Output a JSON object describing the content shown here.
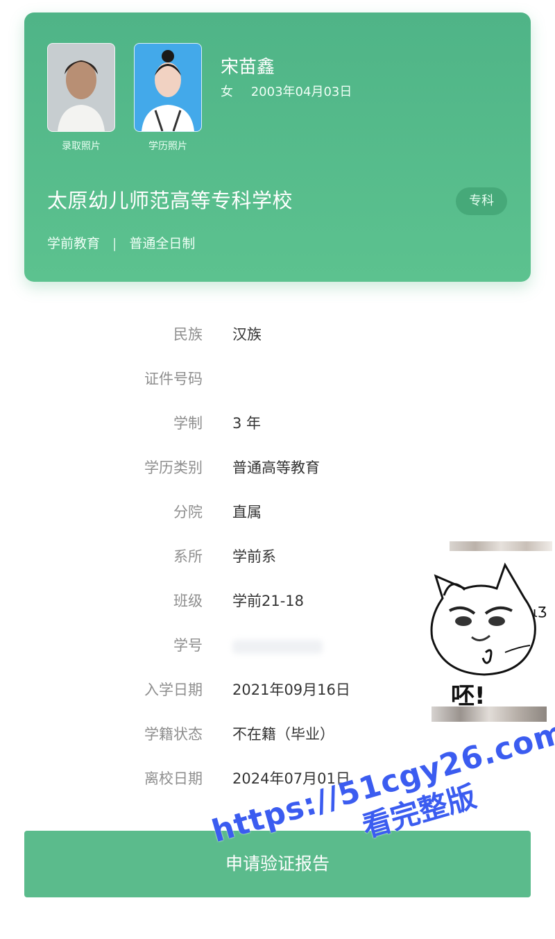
{
  "card": {
    "name": "宋苗鑫",
    "gender": "女",
    "birth_date": "2003年04月03日",
    "photo1_caption": "录取照片",
    "photo2_caption": "学历照片",
    "school": "太原幼儿师范高等专科学校",
    "level_badge": "专科",
    "major": "学前教育",
    "separator": "|",
    "study_form": "普通全日制"
  },
  "details": [
    {
      "label": "民族",
      "value": "汉族"
    },
    {
      "label": "证件号码",
      "value": ""
    },
    {
      "label": "学制",
      "value": "3 年"
    },
    {
      "label": "学历类别",
      "value": "普通高等教育"
    },
    {
      "label": "分院",
      "value": "直属"
    },
    {
      "label": "系所",
      "value": "学前系"
    },
    {
      "label": "班级",
      "value": "学前21-18"
    },
    {
      "label": "学号",
      "value": ""
    },
    {
      "label": "入学日期",
      "value": "2021年09月16日"
    },
    {
      "label": "学籍状态",
      "value": "不在籍（毕业）"
    },
    {
      "label": "离校日期",
      "value": "2024年07月01日"
    }
  ],
  "button": {
    "label": "申请验证报告"
  },
  "sticker": {
    "text": "呸!",
    "scribble": "ɩƷ"
  },
  "watermark": {
    "url": "https://51cgy26.com",
    "text": "看完整版"
  },
  "colors": {
    "card_green": "#5cc28f",
    "button_green": "#5bbb8c",
    "watermark_blue": "#3b5cf0"
  }
}
